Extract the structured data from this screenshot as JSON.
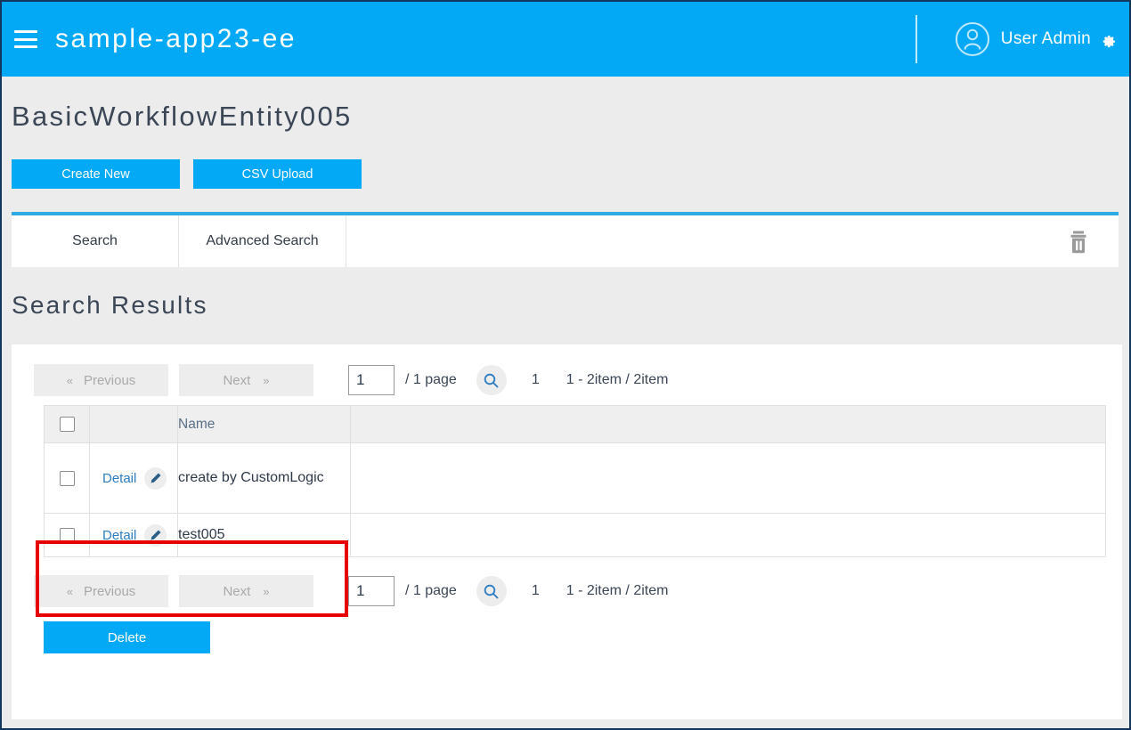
{
  "appbar": {
    "menu_icon": "hamburger-icon",
    "app_title": "sample-app23-ee",
    "avatar_icon": "user-avatar-icon",
    "user_name": "User Admin",
    "settings_icon": "gear-icon",
    "background_color": "#03a9f4"
  },
  "header": {
    "entity_title": "BasicWorkflowEntity005",
    "create_new_label": "Create New",
    "csv_upload_label": "CSV Upload"
  },
  "tabs": {
    "items": [
      {
        "label": "Search",
        "active": true
      },
      {
        "label": "Advanced Search",
        "active": false
      }
    ],
    "trash_icon": "trash-icon",
    "accent_color": "#2eabe2"
  },
  "results": {
    "title": "Search Results",
    "pager_top": {
      "previous_label": "Previous",
      "previous_chevron": "«",
      "next_label": "Next",
      "next_chevron": "»",
      "page_input_value": "1",
      "page_total_label": "/  1 page",
      "search_icon": "magnifier-icon",
      "current_page": "1",
      "item_range": "1 - 2item / 2item"
    },
    "pager_bottom": {
      "previous_label": "Previous",
      "previous_chevron": "«",
      "next_label": "Next",
      "next_chevron": "»",
      "page_input_value": "1",
      "page_total_label": "/  1 page",
      "search_icon": "magnifier-icon",
      "current_page": "1",
      "item_range": "1 - 2item / 2item"
    },
    "table": {
      "headers": {
        "select_all": "",
        "detail": "",
        "name": "Name",
        "extra": ""
      },
      "rows": [
        {
          "checked": false,
          "detail_label": "Detail",
          "edit_icon": "pencil-icon",
          "name": "create by CustomLogic",
          "highlighted": true
        },
        {
          "checked": false,
          "detail_label": "Detail",
          "edit_icon": "pencil-icon",
          "name": "test005",
          "highlighted": false
        }
      ]
    },
    "delete_label": "Delete",
    "highlight_color": "#e60000"
  }
}
